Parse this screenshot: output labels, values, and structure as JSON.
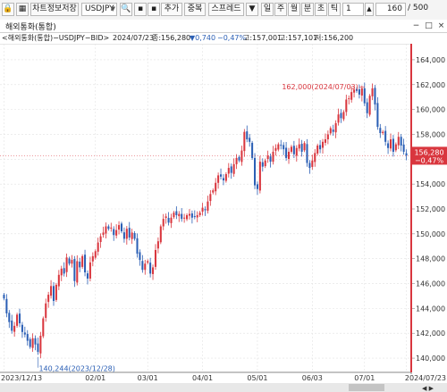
{
  "toolbar": {
    "chart_save_label": "차트정보저장",
    "symbol": "USDJPY",
    "add_label": "추가",
    "overlay_label": "중복",
    "spread_label": "스프레드",
    "period_labels": [
      "일",
      "주",
      "월",
      "분",
      "초",
      "틱"
    ],
    "interval_value": "1",
    "count_value": "160",
    "total_value": "/ 500"
  },
  "tab": {
    "title": "해외통화(통합)"
  },
  "info": {
    "prefix": "<해외통화(통합)−USDJPY−BID>",
    "date": "2024/07/23",
    "close_label": "종:156,280",
    "change": "0,740",
    "change_pct": "−0,47%",
    "high": "고:157,001",
    "low": "고:157,101",
    "low2": "저:156,200"
  },
  "annotations": {
    "high_label": "162,000(2024/07/03)",
    "low_label": "140,244(2023/12/28)"
  },
  "current_price": {
    "value": "156,280",
    "change_pct": "−0,47%"
  },
  "colors": {
    "up": "#d9363e",
    "down": "#2b5fb5",
    "accent": "#d9363e"
  },
  "chart_data": {
    "type": "candlestick",
    "title": "해외통화(통합)−USDJPY−BID (일)",
    "ylim": [
      139,
      165
    ],
    "y_ticks": [
      "140,000",
      "142,000",
      "144,000",
      "146,000",
      "148,000",
      "150,000",
      "152,000",
      "154,000",
      "156,000",
      "158,000",
      "160,000",
      "162,000",
      "164,000"
    ],
    "y_tick_values": [
      140,
      142,
      144,
      146,
      148,
      150,
      152,
      154,
      156,
      158,
      160,
      162,
      164
    ],
    "x_labels": [
      {
        "label": "2023/12/13",
        "i": 0
      },
      {
        "label": "02/01",
        "i": 35
      },
      {
        "label": "03/01",
        "i": 55
      },
      {
        "label": "04/01",
        "i": 76
      },
      {
        "label": "05/01",
        "i": 97
      },
      {
        "label": "06/03",
        "i": 118
      },
      {
        "label": "07/01",
        "i": 138
      },
      {
        "label": "2024/07/23",
        "i": 154
      }
    ],
    "closes": [
      144.8,
      143.6,
      142.9,
      142.2,
      142.6,
      143.5,
      142.8,
      142.1,
      141.9,
      141.4,
      140.9,
      141.6,
      141.1,
      140.5,
      141.8,
      143.2,
      144.4,
      145.1,
      145.8,
      144.6,
      145.9,
      146.7,
      147.2,
      146.8,
      148.1,
      147.6,
      147.9,
      146.2,
      147.8,
      147.3,
      148.2,
      146.9,
      146.4,
      147.7,
      148.2,
      148.6,
      149.3,
      149.8,
      150.1,
      150.6,
      150.4,
      150.5,
      149.9,
      150.3,
      150.7,
      150.2,
      149.6,
      150.4,
      149.7,
      150.1,
      149.6,
      148.4,
      147.9,
      147.1,
      147.6,
      147.8,
      146.8,
      147.3,
      148.7,
      149.4,
      150.6,
      151.2,
      151.4,
      150.9,
      151.3,
      151.7,
      151.5,
      151.6,
      151.2,
      151.3,
      151.5,
      151.6,
      151.3,
      151.4,
      151.5,
      151.7,
      152.1,
      151.9,
      152.6,
      153.2,
      153.5,
      154.1,
      154.7,
      154.6,
      154.3,
      154.8,
      155.3,
      154.9,
      155.6,
      156.1,
      155.9,
      156.7,
      158.2,
      157.6,
      157.4,
      156.1,
      153.9,
      153.6,
      155.8,
      155.4,
      155.9,
      156.3,
      155.8,
      156.6,
      156.9,
      157.2,
      157.1,
      156.8,
      156.1,
      156.6,
      157.0,
      156.4,
      156.9,
      157.2,
      156.6,
      157.3,
      155.7,
      155.3,
      155.9,
      156.5,
      157.1,
      156.8,
      157.4,
      157.6,
      158.0,
      158.5,
      158.2,
      158.9,
      159.6,
      159.3,
      159.8,
      160.8,
      160.9,
      161.4,
      161.6,
      161.5,
      161.2,
      161.7,
      160.5,
      159.7,
      161.1,
      161.7,
      160.4,
      158.6,
      158.1,
      158.2,
      157.4,
      156.9,
      157.6,
      156.6,
      157.2,
      157.8,
      157.1,
      156.6,
      156.3
    ]
  }
}
